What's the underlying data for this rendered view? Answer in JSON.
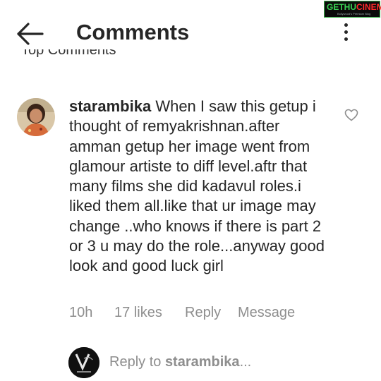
{
  "header": {
    "title": "Comments",
    "back_icon": "arrow-left-icon",
    "menu_icon": "kebab-icon"
  },
  "watermark": {
    "brand_a": "GETHU",
    "brand_b": "CINEMA",
    "tagline": "Bollywood's Premium Blog"
  },
  "section_label": "Top Comments",
  "comment": {
    "username": "starambika",
    "text": "When I saw this getup i thought of  remyakrishnan.after amman getup her image went from glamour artiste to diff level.aftr that many films she did kadavul roles.i liked them all.like that ur image may change ..who knows if there is part 2 or 3 u may do the role...anyway good look and good luck girl",
    "time": "10h",
    "likes": "17 likes",
    "reply_label": "Reply",
    "message_label": "Message"
  },
  "reply_box": {
    "prefix": "Reply to ",
    "target": "starambika",
    "suffix": "..."
  },
  "colors": {
    "text": "#262626",
    "muted": "#8e8e8e",
    "background": "#ffffff"
  }
}
